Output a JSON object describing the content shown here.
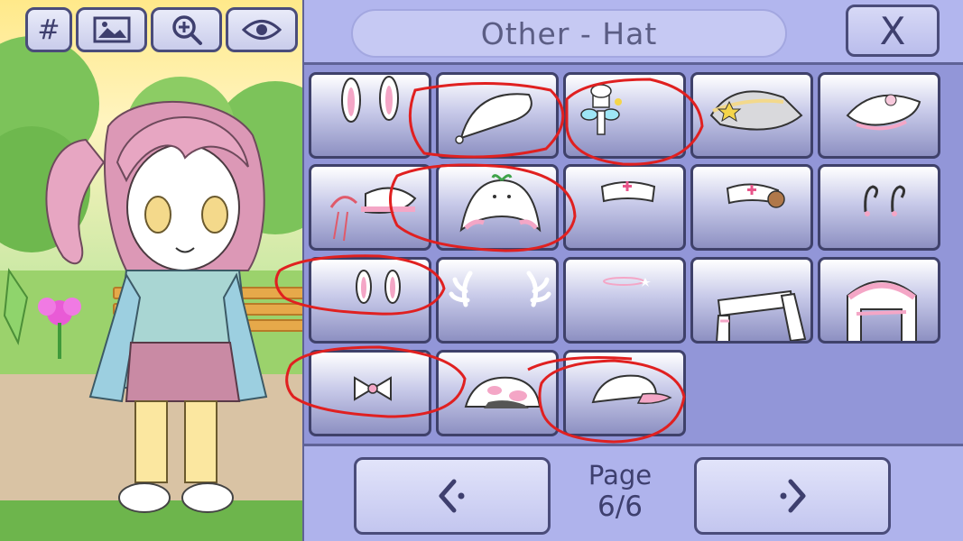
{
  "toolbar": {
    "hash_label": "#",
    "icons": [
      "gallery-icon",
      "zoom-in-icon",
      "eye-icon"
    ]
  },
  "header": {
    "title": "Other - Hat",
    "close_label": "X"
  },
  "grid": {
    "items": [
      {
        "name": "bunny-ears-tall"
      },
      {
        "name": "white-beret"
      },
      {
        "name": "fairy-chef-hat"
      },
      {
        "name": "grey-star-hat"
      },
      {
        "name": "white-peaked-cap"
      },
      {
        "name": "anchor-sailor-hat"
      },
      {
        "name": "sprout-headband"
      },
      {
        "name": "nurse-cap"
      },
      {
        "name": "nurse-cap-bear"
      },
      {
        "name": "small-antennae"
      },
      {
        "name": "bunny-ears-short"
      },
      {
        "name": "antlers"
      },
      {
        "name": "halo"
      },
      {
        "name": "bandage-wrap"
      },
      {
        "name": "bandage-wrap-pink"
      },
      {
        "name": "hair-bow"
      },
      {
        "name": "cow-print-hat"
      },
      {
        "name": "pink-cap"
      }
    ]
  },
  "pagination": {
    "page_label": "Page",
    "page_value": "6/6",
    "prev_icon": "chevron-left-icon",
    "next_icon": "chevron-right-icon"
  },
  "colors": {
    "panel": "#aeb2ec",
    "button_border": "#4a4c7a",
    "annotation": "#e02020"
  }
}
